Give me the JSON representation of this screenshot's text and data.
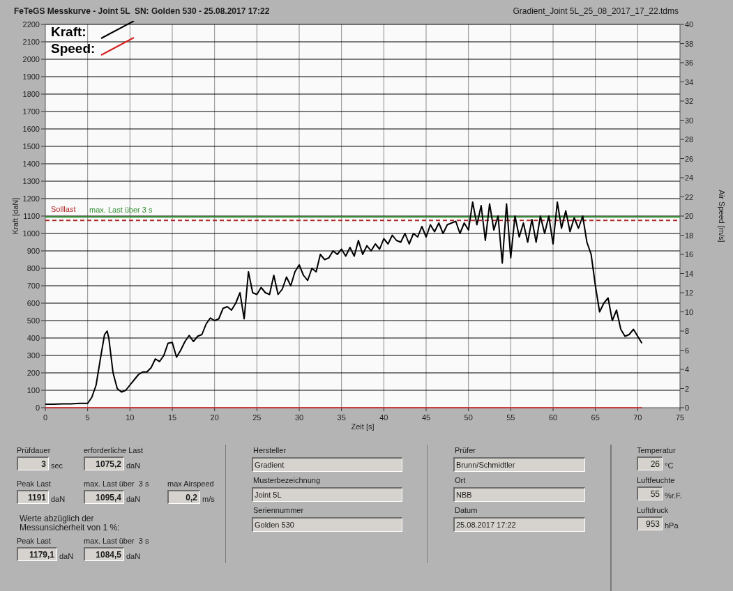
{
  "header": {
    "title": "FeTeGS Messkurve - Joint 5L  SN: Golden 530 - 25.08.2017 17:22",
    "file_name": "Gradient_Joint 5L_25_08_2017_17_22.tdms"
  },
  "chart": {
    "right_axis": {
      "label": "Air Speed [m/s]",
      "ticks": [
        "40",
        "38",
        "36",
        "34",
        "32",
        "30",
        "28",
        "26",
        "24",
        "22",
        "20",
        "18",
        "16",
        "14",
        "12",
        "10",
        "8",
        "6",
        "4",
        "2",
        "0"
      ]
    },
    "chart_data": {
      "type": "line",
      "grid": true,
      "legend": "upper left",
      "xlabel": "Zeit [s]",
      "ylabel": "Kraft [daN]",
      "xlim": [
        0,
        75
      ],
      "ylim": [
        0,
        2200
      ],
      "xticks": [
        0,
        5,
        10,
        15,
        20,
        25,
        30,
        35,
        40,
        45,
        50,
        55,
        60,
        65,
        70,
        75
      ],
      "yticks": [
        0,
        100,
        200,
        300,
        400,
        500,
        600,
        700,
        800,
        900,
        1000,
        1100,
        1200,
        1300,
        1400,
        1500,
        1600,
        1700,
        1800,
        1900,
        2000,
        2100,
        2200
      ],
      "x": [
        0,
        1,
        2,
        3,
        4,
        5,
        5.5,
        6,
        6.5,
        7,
        7.3,
        7.5,
        8,
        8.5,
        9,
        9.5,
        10,
        10.5,
        11,
        11.5,
        12,
        12.5,
        13,
        13.5,
        14,
        14.5,
        15,
        15.5,
        16,
        16.5,
        17,
        17.5,
        18,
        18.5,
        19,
        19.5,
        20,
        20.5,
        21,
        21.5,
        22,
        22.5,
        23,
        23.5,
        24,
        24.5,
        25,
        25.5,
        26,
        26.5,
        27,
        27.5,
        28,
        28.5,
        29,
        29.5,
        30,
        30.5,
        31,
        31.5,
        32,
        32.5,
        33,
        33.5,
        34,
        34.5,
        35,
        35.5,
        36,
        36.5,
        37,
        37.5,
        38,
        38.5,
        39,
        39.5,
        40,
        40.5,
        41,
        41.5,
        42,
        42.5,
        43,
        43.5,
        44,
        44.5,
        45,
        45.5,
        46,
        46.5,
        47,
        47.5,
        48,
        48.5,
        49,
        49.5,
        50,
        50.5,
        51,
        51.5,
        52,
        52.5,
        53,
        53.5,
        54,
        54.5,
        55,
        55.5,
        56,
        56.5,
        57,
        57.5,
        58,
        58.5,
        59,
        59.5,
        60,
        60.5,
        61,
        61.5,
        62,
        62.5,
        63,
        63.5,
        64,
        64.5,
        65,
        65.5,
        66,
        66.5,
        67,
        67.5,
        68,
        68.5,
        69,
        69.5,
        70,
        70.5
      ],
      "series": [
        {
          "name": "Kraft:",
          "color": "#000000",
          "values": [
            20,
            20,
            22,
            22,
            25,
            25,
            60,
            130,
            280,
            420,
            440,
            400,
            200,
            110,
            90,
            100,
            130,
            160,
            190,
            205,
            205,
            230,
            280,
            265,
            300,
            370,
            375,
            290,
            330,
            380,
            415,
            380,
            410,
            420,
            480,
            515,
            500,
            510,
            570,
            580,
            560,
            600,
            660,
            510,
            780,
            660,
            650,
            690,
            660,
            650,
            760,
            650,
            680,
            750,
            700,
            780,
            820,
            760,
            730,
            800,
            780,
            880,
            850,
            860,
            900,
            880,
            910,
            870,
            920,
            870,
            960,
            880,
            930,
            900,
            940,
            910,
            970,
            940,
            990,
            960,
            950,
            1000,
            940,
            1000,
            980,
            1040,
            980,
            1050,
            1010,
            1060,
            1000,
            1050,
            1060,
            1070,
            1000,
            1060,
            1020,
            1180,
            1050,
            1160,
            960,
            1170,
            1020,
            1100,
            830,
            1170,
            860,
            1100,
            980,
            1060,
            950,
            1080,
            950,
            1100,
            1000,
            1100,
            940,
            1180,
            1030,
            1130,
            1010,
            1090,
            1030,
            1100,
            950,
            880,
            700,
            550,
            600,
            630,
            500,
            560,
            450,
            410,
            420,
            450,
            410,
            370
          ]
        },
        {
          "name": "Speed:",
          "color": "#d42020",
          "values": [
            0,
            0,
            0,
            0,
            0,
            0,
            0,
            0,
            0,
            0,
            0,
            0,
            0,
            0,
            0,
            0,
            0,
            0,
            0,
            0,
            0,
            0,
            0,
            0,
            0,
            0,
            0,
            0,
            0,
            0,
            0,
            0,
            0,
            0,
            0,
            0,
            0,
            0,
            0,
            0,
            0,
            0,
            0,
            0,
            0,
            0,
            0,
            0,
            0,
            0,
            0,
            0,
            0,
            0,
            0,
            0,
            0,
            0,
            0,
            0,
            0,
            0,
            0,
            0,
            0,
            0,
            0,
            0,
            0,
            0,
            0,
            0,
            0,
            0,
            0,
            0,
            0,
            0,
            0,
            0,
            0,
            0,
            0,
            0,
            0,
            0,
            0,
            0,
            0,
            0,
            0,
            0,
            0,
            0,
            0,
            0,
            0,
            0,
            0,
            0,
            0,
            0,
            0,
            0,
            0,
            0,
            0,
            0,
            0,
            0,
            0,
            0,
            0,
            0,
            0,
            0,
            0,
            0,
            0,
            0,
            0,
            0,
            0,
            0,
            0,
            0,
            0,
            0,
            0,
            0,
            0,
            0,
            0,
            0,
            0,
            0,
            0,
            0
          ]
        }
      ],
      "ref_lines": [
        {
          "axis": "y",
          "value": 1095.4,
          "label": "max. Last über  3 s",
          "color": "#2e8b2e"
        },
        {
          "axis": "y",
          "value": 1075.2,
          "label": "Solllast",
          "color": "#b02828"
        }
      ]
    }
  },
  "test_results": [
    [
      {
        "label": "Prüfdauer",
        "value": "3",
        "unit": "sec"
      },
      {
        "label": "erforderliche Last",
        "value": "1075,2",
        "unit": "daN"
      }
    ],
    [
      {
        "label": "Peak Last",
        "value": "1191",
        "unit": "daN"
      },
      {
        "label": "max. Last über  3 s",
        "value": "1095,4",
        "unit": "daN"
      },
      {
        "label": "max Airspeed",
        "value": "0,2",
        "unit": "m/s"
      }
    ]
  ],
  "uncertainty_note": "Werte abzüglich der\nMessunsicherheit von 1  %:",
  "corrected_results": [
    {
      "label": "Peak Last",
      "value": "1179,1",
      "unit": "daN"
    },
    {
      "label": "max. Last über  3 s",
      "value": "1084,5",
      "unit": "daN"
    }
  ],
  "sample_fields": [
    {
      "label": "Hersteller",
      "value": "Gradient"
    },
    {
      "label": "Musterbezeichnung",
      "value": "Joint 5L"
    },
    {
      "label": "Seriennummer",
      "value": "Golden 530"
    }
  ],
  "test_fields": [
    {
      "label": "Prüfer",
      "value": "Brunn/Schmidtler"
    },
    {
      "label": "Ort",
      "value": "NBB"
    },
    {
      "label": "Datum",
      "value": "25.08.2017 17:22"
    }
  ],
  "environment": [
    {
      "label": "Temperatur",
      "value": "26",
      "unit": "°C"
    },
    {
      "label": "Luftfeuchte",
      "value": "55",
      "unit": "%r.F."
    },
    {
      "label": "Luftdruck",
      "value": "953",
      "unit": "hPa"
    }
  ]
}
